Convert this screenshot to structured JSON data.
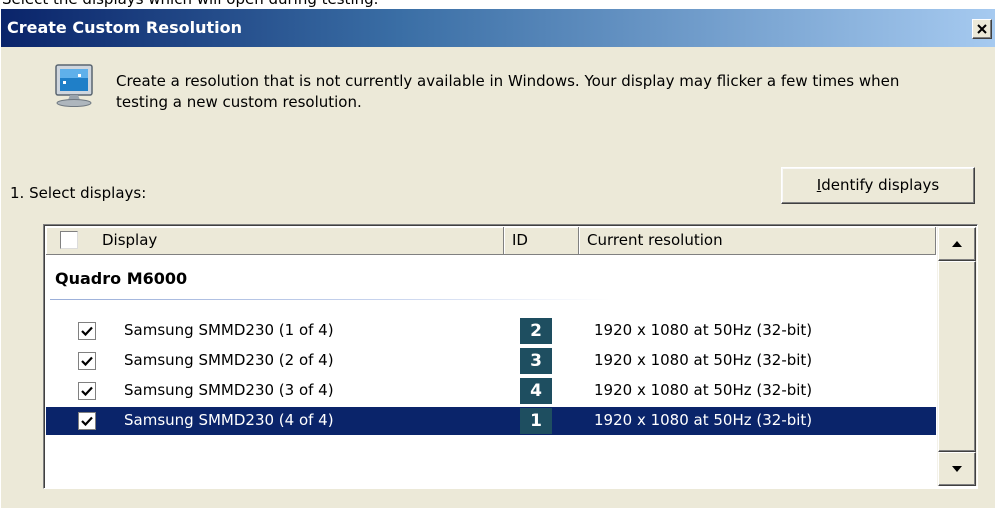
{
  "top_strip_text": "Select the displays which will open during testing.",
  "dialog": {
    "title": "Create Custom Resolution",
    "intro": "Create a resolution that is not currently available in Windows. Your display may flicker a few times when testing a new custom resolution.",
    "step_label": "1. Select displays:",
    "identify_button": {
      "mnemonic": "I",
      "rest": "dentify displays"
    }
  },
  "table": {
    "columns": [
      "Display",
      "ID",
      "Current resolution"
    ],
    "group": "Quadro M6000",
    "rows": [
      {
        "checked": true,
        "name": "Samsung SMMD230 (1 of 4)",
        "id": "2",
        "resolution": "1920 x 1080 at 50Hz (32-bit)",
        "selected": false
      },
      {
        "checked": true,
        "name": "Samsung SMMD230 (2 of 4)",
        "id": "3",
        "resolution": "1920 x 1080 at 50Hz (32-bit)",
        "selected": false
      },
      {
        "checked": true,
        "name": "Samsung SMMD230 (3 of 4)",
        "id": "4",
        "resolution": "1920 x 1080 at 50Hz (32-bit)",
        "selected": false
      },
      {
        "checked": true,
        "name": "Samsung SMMD230 (4 of 4)",
        "id": "1",
        "resolution": "1920 x 1080 at 50Hz (32-bit)",
        "selected": true
      }
    ]
  },
  "icons": {
    "close": "close-icon",
    "monitor": "monitor-icon",
    "scroll_up": "scroll-up-arrow-icon",
    "scroll_down": "scroll-down-arrow-icon",
    "check": "checkmark-icon"
  },
  "colors": {
    "titlebar_start": "#0a246a",
    "titlebar_end": "#a6caf0",
    "selection": "#0a246a",
    "id_badge": "#1e4e60",
    "dialog_bg": "#ece9d8"
  }
}
